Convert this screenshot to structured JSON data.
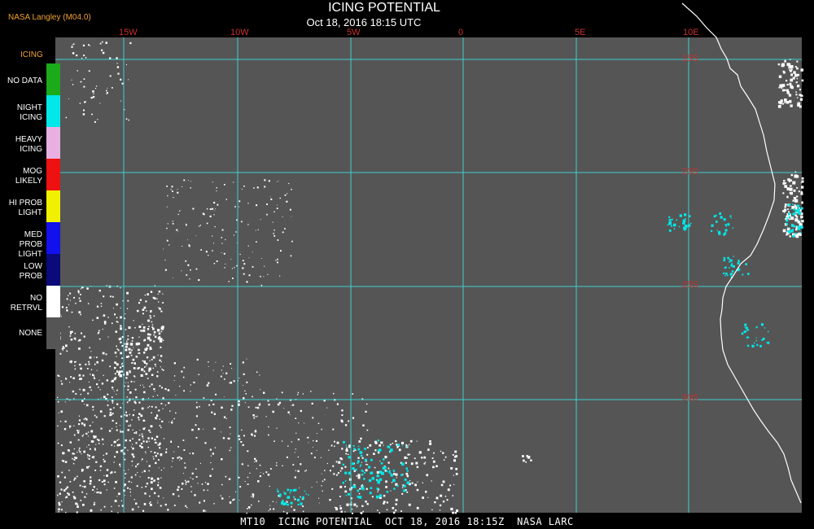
{
  "header": {
    "title": "ICING POTENTIAL",
    "subtitle": "Oct 18, 2016 18:15 UTC",
    "producer": "NASA Langley (M04.0)"
  },
  "legend": {
    "title": "ICING",
    "items": [
      {
        "label_lines": [
          "NO DATA"
        ],
        "color": "#1aaa1a"
      },
      {
        "label_lines": [
          "NIGHT",
          "ICING"
        ],
        "color": "#00e8e8"
      },
      {
        "label_lines": [
          "HEAVY",
          "ICING"
        ],
        "color": "#e8b0e0"
      },
      {
        "label_lines": [
          "MOG",
          "LIKELY"
        ],
        "color": "#ee1111"
      },
      {
        "label_lines": [
          "HI PROB",
          "LIGHT"
        ],
        "color": "#f0f000"
      },
      {
        "label_lines": [
          "MED PROB",
          "LIGHT"
        ],
        "color": "#1111ee"
      },
      {
        "label_lines": [
          "LOW",
          "PROB"
        ],
        "color": "#0a0a7a"
      },
      {
        "label_lines": [
          "NO",
          "RETRVL"
        ],
        "color": "#ffffff"
      },
      {
        "label_lines": [
          "NONE"
        ],
        "color": "#555555"
      }
    ]
  },
  "map": {
    "background_color": "#555555",
    "grid_color": "#40d0d0",
    "coastline_color": "#ffffff",
    "longitude_labels": [
      "15W",
      "10W",
      "5W",
      "0",
      "5E",
      "10E"
    ],
    "latitude_labels": [
      "15S",
      "20S",
      "25S",
      "30S"
    ]
  },
  "footer": {
    "text": "MT10  ICING POTENTIAL  OCT 18, 2016 18:15Z  NASA LARC"
  }
}
